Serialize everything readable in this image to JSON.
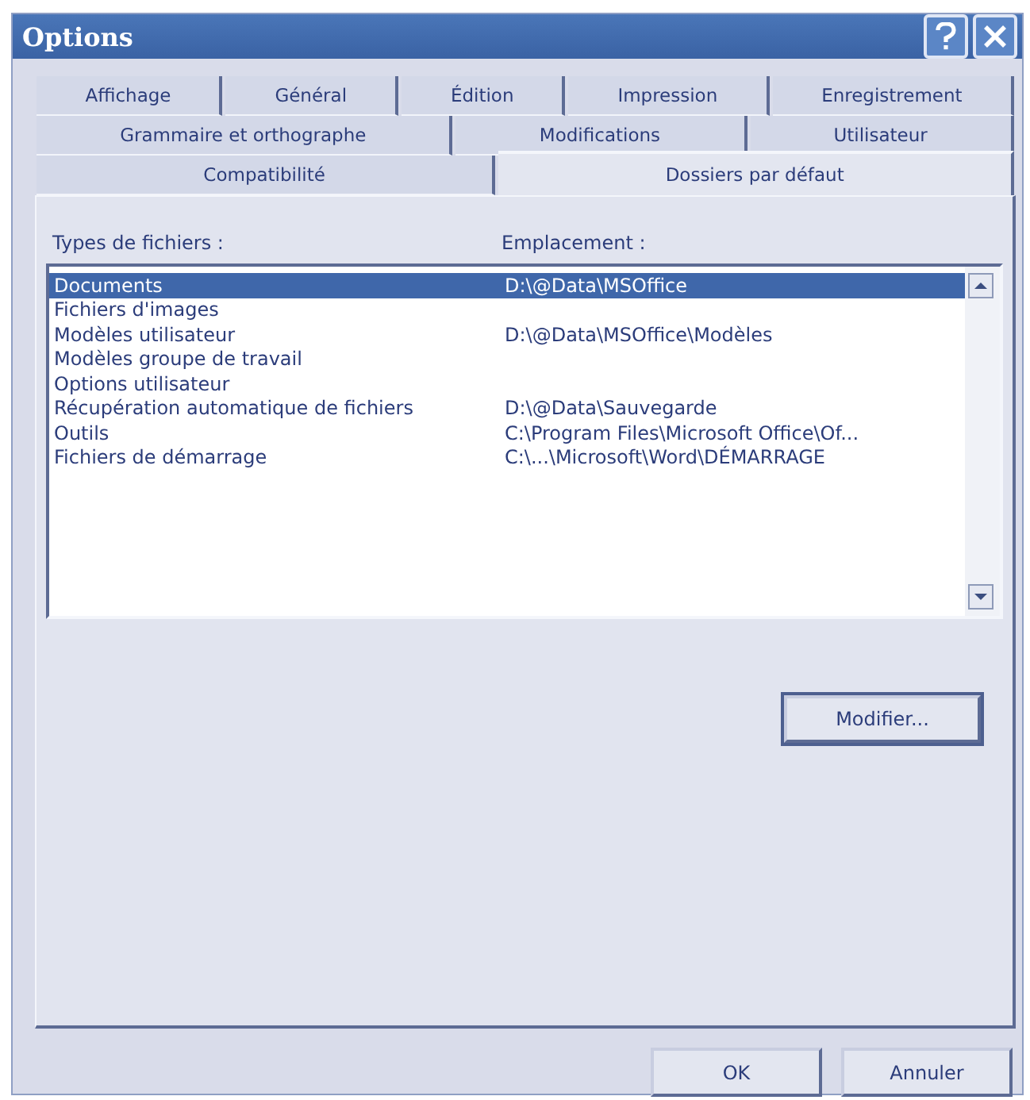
{
  "window": {
    "title": "Options"
  },
  "tab_rows": [
    [
      {
        "label": "Affichage",
        "selected": false
      },
      {
        "label": "Général",
        "selected": false
      },
      {
        "label": "Édition",
        "selected": false
      },
      {
        "label": "Impression",
        "selected": false
      },
      {
        "label": "Enregistrement",
        "selected": false
      }
    ],
    [
      {
        "label": "Grammaire et orthographe",
        "selected": false
      },
      {
        "label": "Modifications",
        "selected": false
      },
      {
        "label": "Utilisateur",
        "selected": false
      }
    ],
    [
      {
        "label": "Compatibilité",
        "selected": false
      },
      {
        "label": "Dossiers par défaut",
        "selected": true
      }
    ]
  ],
  "file_list": {
    "columns": [
      "Types de fichiers :",
      "Emplacement :"
    ],
    "rows": [
      {
        "type": "Documents",
        "location": "D:\\@Data\\MSOffice",
        "selected": true
      },
      {
        "type": "Fichiers d'images",
        "location": "",
        "selected": false
      },
      {
        "type": "Modèles utilisateur",
        "location": "D:\\@Data\\MSOffice\\Modèles",
        "selected": false
      },
      {
        "type": "Modèles groupe de travail",
        "location": "",
        "selected": false
      },
      {
        "type": "Options utilisateur",
        "location": "",
        "selected": false
      },
      {
        "type": "Récupération automatique de fichiers",
        "location": "D:\\@Data\\Sauvegarde",
        "selected": false
      },
      {
        "type": "Outils",
        "location": "C:\\Program Files\\Microsoft Office\\Of...",
        "selected": false
      },
      {
        "type": "Fichiers de démarrage",
        "location": "C:\\...\\Microsoft\\Word\\DÉMARRAGE",
        "selected": false
      }
    ]
  },
  "modify_button": "Modifier...",
  "buttons": [
    "OK",
    "Annuler"
  ]
}
